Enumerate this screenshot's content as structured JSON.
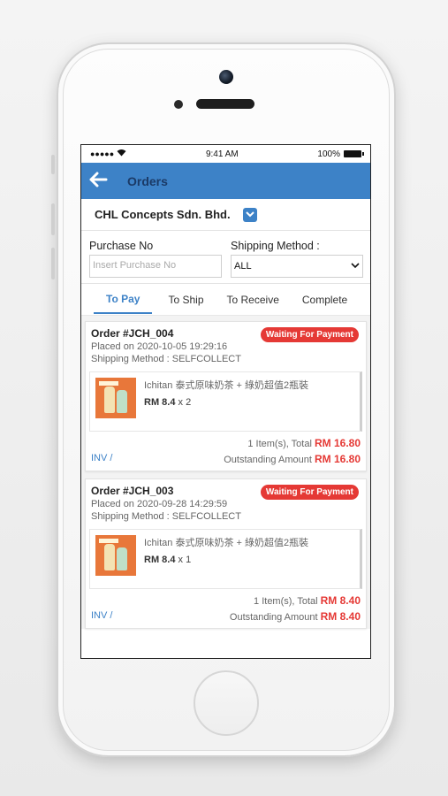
{
  "status_bar": {
    "signal": "●●●●●",
    "time": "9:41 AM",
    "battery": "100%"
  },
  "app_bar": {
    "title": "Orders"
  },
  "company": {
    "name": "CHL Concepts Sdn. Bhd."
  },
  "filters": {
    "purchase_label": "Purchase No",
    "purchase_placeholder": "Insert Purchase No",
    "shipping_label": "Shipping Method :",
    "shipping_value": "ALL"
  },
  "tabs": [
    {
      "label": "To Pay",
      "active": true
    },
    {
      "label": "To Ship"
    },
    {
      "label": "To Receive"
    },
    {
      "label": "Complete"
    }
  ],
  "orders": [
    {
      "id": "Order #JCH_004",
      "status": "Waiting For Payment",
      "placed": "Placed on 2020-10-05 19:29:16",
      "shipping": "Shipping Method : SELFCOLLECT",
      "item_name": "Ichitan 泰式原味奶茶 + 綠奶超值2瓶裝",
      "price": "RM 8.4",
      "qty": " x 2",
      "items_total_label": "1 Item(s), Total",
      "items_total": "RM 16.80",
      "inv": "INV /",
      "outstanding_label": "Outstanding Amount",
      "outstanding": "RM 16.80"
    },
    {
      "id": "Order #JCH_003",
      "status": "Waiting For Payment",
      "placed": "Placed on 2020-09-28 14:29:59",
      "shipping": "Shipping Method : SELFCOLLECT",
      "item_name": "Ichitan 泰式原味奶茶 + 綠奶超值2瓶裝",
      "price": "RM 8.4",
      "qty": " x 1",
      "items_total_label": "1 Item(s), Total",
      "items_total": "RM 8.40",
      "inv": "INV /",
      "outstanding_label": "Outstanding Amount",
      "outstanding": "RM 8.40"
    }
  ],
  "colors": {
    "primary": "#3d82c7",
    "danger": "#e53935"
  }
}
